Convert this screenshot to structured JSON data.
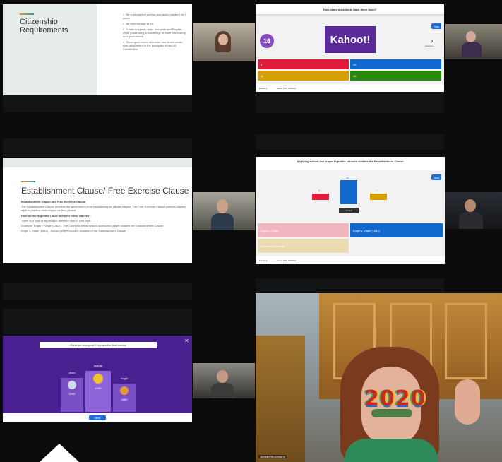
{
  "slide1": {
    "title": "Citizenship Requirements",
    "items": [
      "Be a permanent person and lawful resident for 5 years",
      "Be over the age of 18",
      "Is able to speak, read, and write and English while possessing a knowledge of American history and government",
      "Show good moral character and demonstrate their attachment to the principles of the US Constitution"
    ]
  },
  "kahoot_question": {
    "question": "How many presidents have there been?",
    "timer": "16",
    "logo": "Kahoot!",
    "skip_label": "Skip",
    "answers_count": "0",
    "answers_label": "Answers",
    "footer_left": "kahoot.it",
    "footer_mid": "Game PIN: 7654321",
    "options": [
      {
        "label": "41",
        "color": "#e21b3c"
      },
      {
        "label": "43",
        "color": "#1368ce"
      },
      {
        "label": "44",
        "color": "#d89e00"
      },
      {
        "label": "45",
        "color": "#26890c"
      }
    ]
  },
  "slide2": {
    "title": "Establishment Clause/ Free Exercise Clause",
    "heading1": "Establishment Clause and Free Exercise Clause",
    "para1": "The Establishment Clause prohibits the government from establishing an official religion. The Free Exercise Clause protects citizens' right to practice their religion as they please.",
    "heading2": "How do the Supreme Court interpret these clauses?",
    "para2": "There is a 'wall of separation' between church and state.",
    "para3": "Example: Engel v. Vitale (1962) - The Court ruled that school-sponsored prayer violates the Establishment Clause.",
    "para4": "Engel v. Vitale (1962) - School prayer found in violation of the Establishment Clause"
  },
  "kahoot_results": {
    "question": "Applying school-led prayer in public schools violates the Establishment Clause",
    "next_label": "Next",
    "bars": [
      {
        "value": 1,
        "color": "#e21b3c"
      },
      {
        "value": 12,
        "color": "#1368ce"
      },
      {
        "value": 1,
        "color": "#d89e00"
      }
    ],
    "bar_labels": [
      "1",
      "12",
      "1"
    ],
    "correct_tag": "Correct",
    "options": [
      {
        "label": "Engel v. Vitale",
        "color": "#f1b6bf"
      },
      {
        "label": "Engel v. Vitale (1962)",
        "color": "#1368ce"
      },
      {
        "label": "Lemon v. Kurtzman",
        "color": "#eadcb0"
      }
    ],
    "footer_left": "kahoot.it",
    "footer_mid": "Game PIN: 7654321"
  },
  "podium": {
    "banner": "Great job everyone! Here are the final results",
    "places": [
      {
        "name": "ofclin",
        "score": "3245",
        "rank": "2"
      },
      {
        "name": "mandy",
        "score": "4160",
        "rank": "1"
      },
      {
        "name": "ricgirl",
        "score": "2889",
        "rank": "3"
      }
    ],
    "button": "Next"
  },
  "teacher": {
    "name_label": "Jennifer Brochmann",
    "glasses_text": "2020"
  }
}
